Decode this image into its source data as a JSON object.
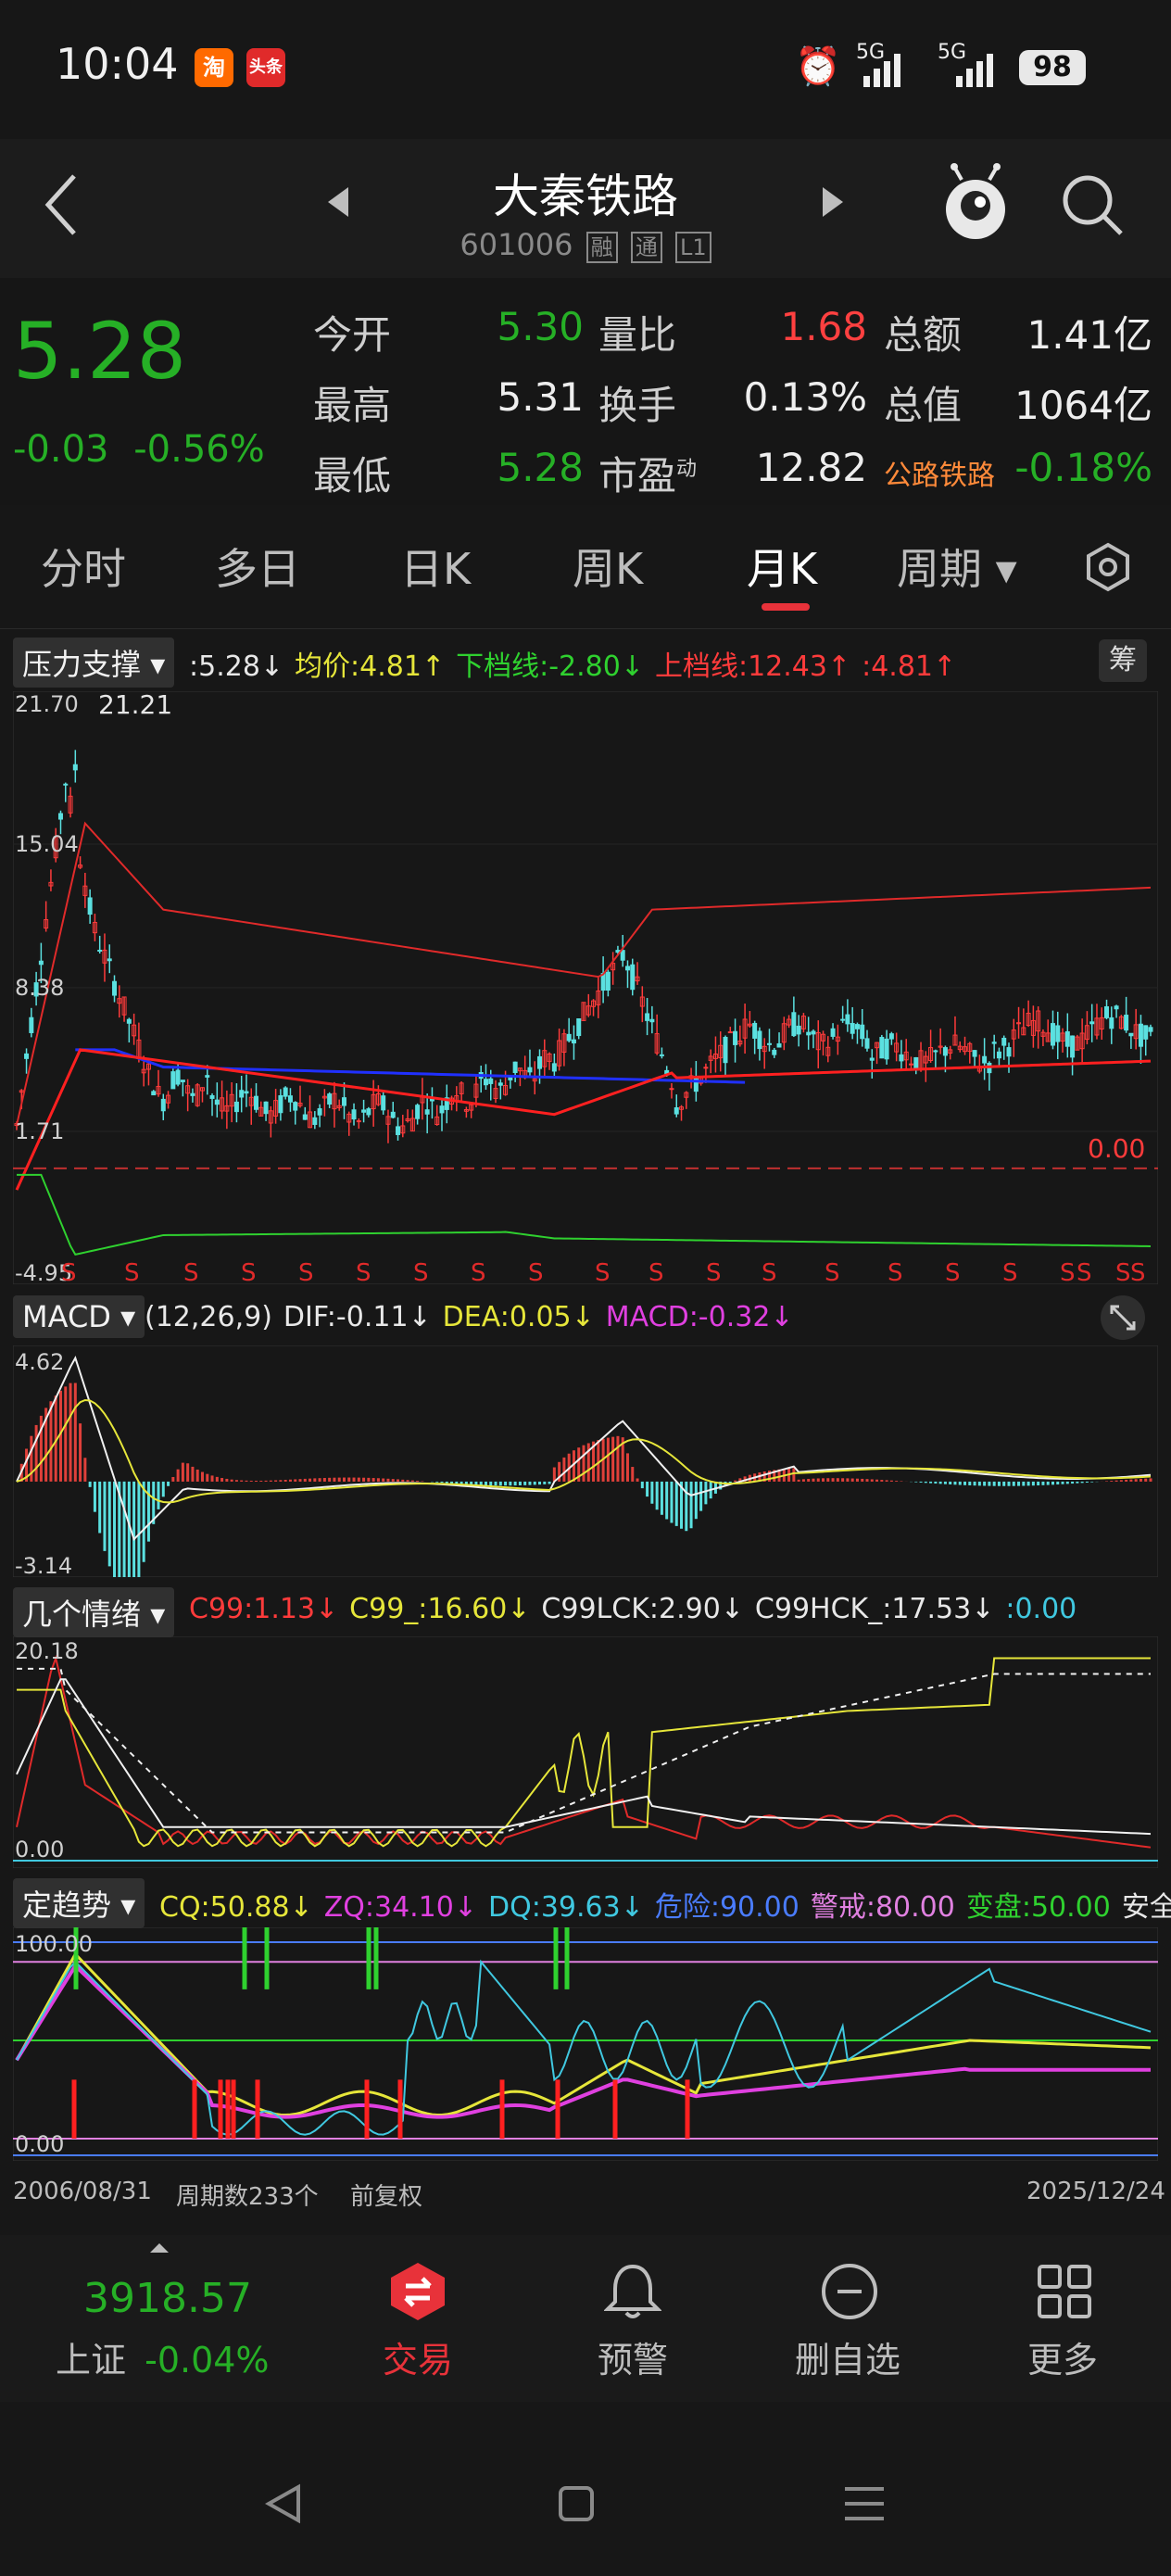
{
  "status_bar": {
    "time": "10:04",
    "app1": "淘",
    "app2": "头条",
    "signal1": "5G",
    "signal2": "5G",
    "battery": "98"
  },
  "header": {
    "title": "大秦铁路",
    "code": "601006",
    "tags": [
      "融",
      "通",
      "L1"
    ]
  },
  "quote": {
    "price": "5.28",
    "change": "-0.03",
    "change_pct": "-0.56%",
    "rows": [
      [
        {
          "l": "今开",
          "v": "5.30",
          "c": "#26b026"
        },
        {
          "l": "量比",
          "v": "1.68",
          "c": "#ff4040"
        },
        {
          "l": "总额",
          "v": "1.41亿",
          "c": "#eeeeee"
        }
      ],
      [
        {
          "l": "最高",
          "v": "5.31",
          "c": "#eeeeee"
        },
        {
          "l": "换手",
          "v": "0.13%",
          "c": "#eeeeee"
        },
        {
          "l": "总值",
          "v": "1064亿",
          "c": "#eeeeee"
        }
      ],
      [
        {
          "l": "最低",
          "v": "5.28",
          "c": "#26b026"
        },
        {
          "l": "市盈",
          "v": "12.82",
          "c": "#eeeeee"
        },
        {
          "l": "公路铁路",
          "v": "-0.18%",
          "c": "#26b026"
        }
      ]
    ],
    "pe_sup": "动"
  },
  "tabs": [
    "分时",
    "多日",
    "日K",
    "周K",
    "月K",
    "周期"
  ],
  "selected_tab": "月K",
  "main_chart": {
    "indicator": "压力支撑",
    "legend": [
      {
        "t": ":5.28↓",
        "c": "#e8e8e8"
      },
      {
        "t": "均价:4.81↑",
        "c": "#e6e63a"
      },
      {
        "t": "下档线:-2.80↓",
        "c": "#2fd12f"
      },
      {
        "t": "上档线:12.43↑",
        "c": "#ff3b3b"
      },
      {
        "t": ":4.81↑",
        "c": "#ff3b3b"
      }
    ],
    "chip_btn": "筹",
    "y_labels": [
      "21.70",
      "15.04",
      "8.38",
      "1.71",
      "-4.95"
    ],
    "peak_label": "21.21",
    "zero_label": "0.00",
    "s_marker": "S"
  },
  "macd": {
    "name": "MACD",
    "legend": [
      {
        "t": "(12,26,9)",
        "c": "#e8e8e8"
      },
      {
        "t": "DIF:-0.11↓",
        "c": "#e8e8e8"
      },
      {
        "t": "DEA:0.05↓",
        "c": "#e6e63a"
      },
      {
        "t": "MACD:-0.32↓",
        "c": "#e040e0"
      }
    ],
    "y_labels": [
      "4.62",
      "-3.14"
    ]
  },
  "mood": {
    "name": "几个情绪",
    "legend": [
      {
        "t": "C99:1.13↓",
        "c": "#ff3b3b"
      },
      {
        "t": "C99_:16.60↓",
        "c": "#e6e63a"
      },
      {
        "t": "C99LCK:2.90↓",
        "c": "#e8e8e8"
      },
      {
        "t": "C99HCK_:17.53↓",
        "c": "#e8e8e8"
      },
      {
        "t": ":0.00",
        "c": "#40c8e0"
      }
    ],
    "y_labels": [
      "20.18",
      "0.00"
    ]
  },
  "trend": {
    "name": "定趋势",
    "legend": [
      {
        "t": "CQ:50.88↓",
        "c": "#e6e63a"
      },
      {
        "t": "ZQ:34.10↓",
        "c": "#e040e0"
      },
      {
        "t": "DQ:39.63↓",
        "c": "#40c8e0"
      },
      {
        "t": "危险:90.00",
        "c": "#4a7cff"
      },
      {
        "t": "警戒:80.00",
        "c": "#e080e0"
      },
      {
        "t": "变盘:50.00",
        "c": "#2fd12f"
      },
      {
        "t": "安全:",
        "c": "#e8e8e8"
      }
    ],
    "y_labels": [
      "100.00",
      "0.00"
    ]
  },
  "footer": {
    "start_date": "2006/08/31",
    "periods": "周期数233个",
    "adjust": "前复权",
    "end_date": "2025/12/24"
  },
  "bottom_nav": {
    "index_value": "3918.57",
    "index_name": "上证",
    "index_change": "-0.04%",
    "items": [
      "交易",
      "预警",
      "删自选",
      "更多"
    ]
  }
}
